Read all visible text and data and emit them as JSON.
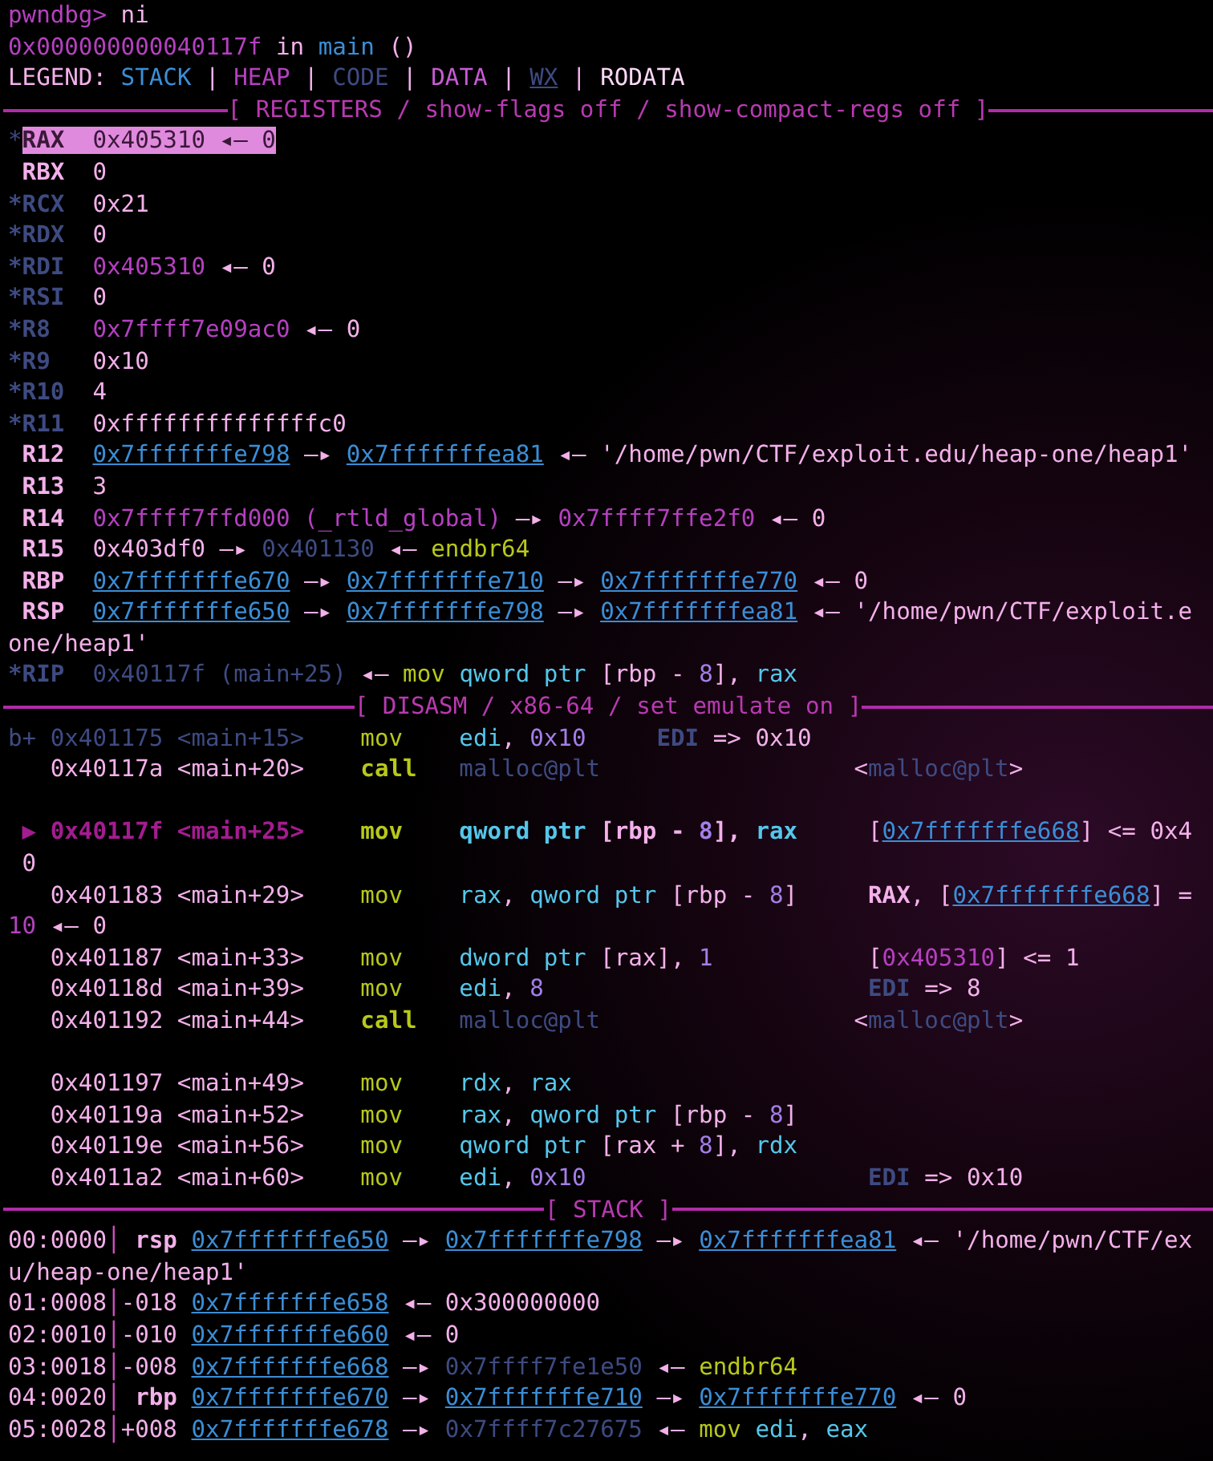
{
  "terminal": {
    "lines": [
      {
        "kind": "text",
        "segments": [
          {
            "text": "pwndbg> ",
            "kind": "heap"
          },
          {
            "text": "ni",
            "kind": "fg"
          }
        ]
      },
      {
        "kind": "text",
        "segments": [
          {
            "text": "0x000000000040117f",
            "kind": "heap"
          },
          {
            "text": " in ",
            "kind": "fg"
          },
          {
            "text": "main",
            "kind": "blue"
          },
          {
            "text": " ()",
            "kind": "fg"
          }
        ]
      },
      {
        "kind": "text",
        "segments": [
          {
            "text": "LEGEND: ",
            "kind": "fg"
          },
          {
            "text": "STACK",
            "kind": "blue"
          },
          {
            "text": " | ",
            "kind": "fg"
          },
          {
            "text": "HEAP",
            "kind": "heap"
          },
          {
            "text": " | ",
            "kind": "fg"
          },
          {
            "text": "CODE",
            "kind": "code"
          },
          {
            "text": " | ",
            "kind": "fg"
          },
          {
            "text": "DATA",
            "kind": "data"
          },
          {
            "text": " | ",
            "kind": "fg"
          },
          {
            "text": "WX",
            "kind": "wx"
          },
          {
            "text": " | ",
            "kind": "fg"
          },
          {
            "text": "RODATA",
            "kind": "rodata"
          }
        ]
      },
      {
        "kind": "rule",
        "title": "[ REGISTERS / show-flags off / show-compact-regs off ]"
      },
      {
        "kind": "text",
        "segments": [
          {
            "text": "*",
            "kind": "code"
          },
          {
            "text": "RAX",
            "kind": "hl-bold"
          },
          {
            "text": "  0x405310 ◂— 0",
            "kind": "hl"
          }
        ]
      },
      {
        "kind": "text",
        "segments": [
          {
            "text": " RBX",
            "kind": "fg-bold"
          },
          {
            "text": "  0",
            "kind": "fg"
          }
        ]
      },
      {
        "kind": "text",
        "segments": [
          {
            "text": "*RCX",
            "kind": "code-bold"
          },
          {
            "text": "  0x21",
            "kind": "fg"
          }
        ]
      },
      {
        "kind": "text",
        "segments": [
          {
            "text": "*RDX",
            "kind": "code-bold"
          },
          {
            "text": "  0",
            "kind": "fg"
          }
        ]
      },
      {
        "kind": "text",
        "segments": [
          {
            "text": "*RDI",
            "kind": "code-bold"
          },
          {
            "text": "  0x405310",
            "kind": "heap"
          },
          {
            "text": " ◂— 0",
            "kind": "fg"
          }
        ]
      },
      {
        "kind": "text",
        "segments": [
          {
            "text": "*RSI",
            "kind": "code-bold"
          },
          {
            "text": "  0",
            "kind": "fg"
          }
        ]
      },
      {
        "kind": "text",
        "segments": [
          {
            "text": "*R8",
            "kind": "code-bold"
          },
          {
            "text": "   0x7ffff7e09ac0",
            "kind": "heap"
          },
          {
            "text": " ◂— 0",
            "kind": "fg"
          }
        ]
      },
      {
        "kind": "text",
        "segments": [
          {
            "text": "*R9",
            "kind": "code-bold"
          },
          {
            "text": "   0x10",
            "kind": "fg"
          }
        ]
      },
      {
        "kind": "text",
        "segments": [
          {
            "text": "*R10",
            "kind": "code-bold"
          },
          {
            "text": "  4",
            "kind": "fg"
          }
        ]
      },
      {
        "kind": "text",
        "segments": [
          {
            "text": "*R11",
            "kind": "code-bold"
          },
          {
            "text": "  0xffffffffffffffc0",
            "kind": "fg"
          }
        ]
      },
      {
        "kind": "text",
        "segments": [
          {
            "text": " R12  ",
            "kind": "fg-bold"
          },
          {
            "text": "0x7fffffffe798",
            "kind": "stack"
          },
          {
            "text": " —▸ ",
            "kind": "fg"
          },
          {
            "text": "0x7fffffffea81",
            "kind": "stack"
          },
          {
            "text": " ◂— '/home/pwn/CTF/exploit.edu/heap-one/heap1'",
            "kind": "fg"
          }
        ]
      },
      {
        "kind": "text",
        "segments": [
          {
            "text": " R13",
            "kind": "fg-bold"
          },
          {
            "text": "  3",
            "kind": "fg"
          }
        ]
      },
      {
        "kind": "text",
        "segments": [
          {
            "text": " R14",
            "kind": "fg-bold"
          },
          {
            "text": "  0x7ffff7ffd000 (_rtld_global)",
            "kind": "heap"
          },
          {
            "text": " —▸ ",
            "kind": "fg"
          },
          {
            "text": "0x7ffff7ffe2f0",
            "kind": "heap"
          },
          {
            "text": " ◂— 0",
            "kind": "fg"
          }
        ]
      },
      {
        "kind": "text",
        "segments": [
          {
            "text": " R15",
            "kind": "fg-bold"
          },
          {
            "text": "  0x403df0 —▸ ",
            "kind": "fg"
          },
          {
            "text": "0x401130",
            "kind": "code"
          },
          {
            "text": " ◂— ",
            "kind": "fg"
          },
          {
            "text": "endbr64",
            "kind": "yellow"
          }
        ]
      },
      {
        "kind": "text",
        "segments": [
          {
            "text": " RBP  ",
            "kind": "fg-bold"
          },
          {
            "text": "0x7fffffffe670",
            "kind": "stack"
          },
          {
            "text": " —▸ ",
            "kind": "fg"
          },
          {
            "text": "0x7fffffffe710",
            "kind": "stack"
          },
          {
            "text": " —▸ ",
            "kind": "fg"
          },
          {
            "text": "0x7fffffffe770",
            "kind": "stack"
          },
          {
            "text": " ◂— 0",
            "kind": "fg"
          }
        ]
      },
      {
        "kind": "text",
        "segments": [
          {
            "text": " RSP  ",
            "kind": "fg-bold"
          },
          {
            "text": "0x7fffffffe650",
            "kind": "stack"
          },
          {
            "text": " —▸ ",
            "kind": "fg"
          },
          {
            "text": "0x7fffffffe798",
            "kind": "stack"
          },
          {
            "text": " —▸ ",
            "kind": "fg"
          },
          {
            "text": "0x7fffffffea81",
            "kind": "stack"
          },
          {
            "text": " ◂— '/home/pwn/CTF/exploit.e",
            "kind": "fg"
          }
        ]
      },
      {
        "kind": "text",
        "segments": [
          {
            "text": "one/heap1'",
            "kind": "fg"
          }
        ]
      },
      {
        "kind": "text",
        "segments": [
          {
            "text": "*RIP",
            "kind": "code-bold"
          },
          {
            "text": "  0x40117f (main+25)",
            "kind": "code"
          },
          {
            "text": " ◂— ",
            "kind": "fg"
          },
          {
            "text": "mov ",
            "kind": "yellow"
          },
          {
            "text": "qword ptr",
            "kind": "cyan"
          },
          {
            "text": " [rbp - ",
            "kind": "fg"
          },
          {
            "text": "8",
            "kind": "num"
          },
          {
            "text": "], ",
            "kind": "fg"
          },
          {
            "text": "rax",
            "kind": "cyan"
          }
        ]
      },
      {
        "kind": "rule",
        "title": "[ DISASM / x86-64 / set emulate on ]"
      },
      {
        "kind": "text",
        "segments": [
          {
            "text": "b+ 0x401175 <main+15>    ",
            "kind": "code"
          },
          {
            "text": "mov    ",
            "kind": "yellow"
          },
          {
            "text": "edi",
            "kind": "cyan"
          },
          {
            "text": ", ",
            "kind": "fg"
          },
          {
            "text": "0x10     ",
            "kind": "num"
          },
          {
            "text": "EDI",
            "kind": "code-bold"
          },
          {
            "text": " => 0x10",
            "kind": "fg"
          }
        ]
      },
      {
        "kind": "text",
        "segments": [
          {
            "text": "   0x40117a <main+20>    ",
            "kind": "fg"
          },
          {
            "text": "call   ",
            "kind": "yellow-bold"
          },
          {
            "text": "malloc@plt",
            "kind": "code"
          },
          {
            "text": "                  <",
            "kind": "fg"
          },
          {
            "text": "malloc@plt",
            "kind": "code"
          },
          {
            "text": ">",
            "kind": "fg"
          }
        ]
      },
      {
        "kind": "blank"
      },
      {
        "kind": "text",
        "segments": [
          {
            "text": " ▶ 0x40117f <main+25>    ",
            "kind": "heap-bold"
          },
          {
            "text": "mov    ",
            "kind": "yellow-bold"
          },
          {
            "text": "qword ptr",
            "kind": "cyan-bold"
          },
          {
            "text": " [rbp - ",
            "kind": "fg-bold"
          },
          {
            "text": "8",
            "kind": "num-bold"
          },
          {
            "text": "], ",
            "kind": "fg-bold"
          },
          {
            "text": "rax",
            "kind": "cyan-bold"
          },
          {
            "text": "     [",
            "kind": "fg"
          },
          {
            "text": "0x7fffffffe668",
            "kind": "stack"
          },
          {
            "text": "] <= 0x4",
            "kind": "fg"
          }
        ]
      },
      {
        "kind": "text",
        "segments": [
          {
            "text": " 0",
            "kind": "fg"
          }
        ]
      },
      {
        "kind": "text",
        "segments": [
          {
            "text": "   0x401183 <main+29>    ",
            "kind": "fg"
          },
          {
            "text": "mov    ",
            "kind": "yellow"
          },
          {
            "text": "rax",
            "kind": "cyan"
          },
          {
            "text": ", ",
            "kind": "fg"
          },
          {
            "text": "qword ptr",
            "kind": "cyan"
          },
          {
            "text": " [rbp - ",
            "kind": "fg"
          },
          {
            "text": "8",
            "kind": "num"
          },
          {
            "text": "]     ",
            "kind": "fg"
          },
          {
            "text": "RAX",
            "kind": "fg-bold"
          },
          {
            "text": ", [",
            "kind": "fg"
          },
          {
            "text": "0x7fffffffe668",
            "kind": "stack"
          },
          {
            "text": "] =",
            "kind": "fg"
          }
        ]
      },
      {
        "kind": "text",
        "segments": [
          {
            "text": "10",
            "kind": "heap"
          },
          {
            "text": " ◂— 0",
            "kind": "fg"
          }
        ]
      },
      {
        "kind": "text",
        "segments": [
          {
            "text": "   0x401187 <main+33>    ",
            "kind": "fg"
          },
          {
            "text": "mov    ",
            "kind": "yellow"
          },
          {
            "text": "dword ptr",
            "kind": "cyan"
          },
          {
            "text": " [rax], ",
            "kind": "fg"
          },
          {
            "text": "1",
            "kind": "num"
          },
          {
            "text": "           [",
            "kind": "fg"
          },
          {
            "text": "0x405310",
            "kind": "heap"
          },
          {
            "text": "] <= 1",
            "kind": "fg"
          }
        ]
      },
      {
        "kind": "text",
        "segments": [
          {
            "text": "   0x40118d <main+39>    ",
            "kind": "fg"
          },
          {
            "text": "mov    ",
            "kind": "yellow"
          },
          {
            "text": "edi",
            "kind": "cyan"
          },
          {
            "text": ", ",
            "kind": "fg"
          },
          {
            "text": "8                       ",
            "kind": "num"
          },
          {
            "text": "EDI",
            "kind": "code-bold"
          },
          {
            "text": " => 8",
            "kind": "fg"
          }
        ]
      },
      {
        "kind": "text",
        "segments": [
          {
            "text": "   0x401192 <main+44>    ",
            "kind": "fg"
          },
          {
            "text": "call   ",
            "kind": "yellow-bold"
          },
          {
            "text": "malloc@plt",
            "kind": "code"
          },
          {
            "text": "                  <",
            "kind": "fg"
          },
          {
            "text": "malloc@plt",
            "kind": "code"
          },
          {
            "text": ">",
            "kind": "fg"
          }
        ]
      },
      {
        "kind": "blank"
      },
      {
        "kind": "text",
        "segments": [
          {
            "text": "   0x401197 <main+49>    ",
            "kind": "fg"
          },
          {
            "text": "mov    ",
            "kind": "yellow"
          },
          {
            "text": "rdx",
            "kind": "cyan"
          },
          {
            "text": ", ",
            "kind": "fg"
          },
          {
            "text": "rax",
            "kind": "cyan"
          }
        ]
      },
      {
        "kind": "text",
        "segments": [
          {
            "text": "   0x40119a <main+52>    ",
            "kind": "fg"
          },
          {
            "text": "mov    ",
            "kind": "yellow"
          },
          {
            "text": "rax",
            "kind": "cyan"
          },
          {
            "text": ", ",
            "kind": "fg"
          },
          {
            "text": "qword ptr",
            "kind": "cyan"
          },
          {
            "text": " [rbp - ",
            "kind": "fg"
          },
          {
            "text": "8",
            "kind": "num"
          },
          {
            "text": "]",
            "kind": "fg"
          }
        ]
      },
      {
        "kind": "text",
        "segments": [
          {
            "text": "   0x40119e <main+56>    ",
            "kind": "fg"
          },
          {
            "text": "mov    ",
            "kind": "yellow"
          },
          {
            "text": "qword ptr",
            "kind": "cyan"
          },
          {
            "text": " [rax + ",
            "kind": "fg"
          },
          {
            "text": "8",
            "kind": "num"
          },
          {
            "text": "], ",
            "kind": "fg"
          },
          {
            "text": "rdx",
            "kind": "cyan"
          }
        ]
      },
      {
        "kind": "text",
        "segments": [
          {
            "text": "   0x4011a2 <main+60>    ",
            "kind": "fg"
          },
          {
            "text": "mov    ",
            "kind": "yellow"
          },
          {
            "text": "edi",
            "kind": "cyan"
          },
          {
            "text": ", ",
            "kind": "fg"
          },
          {
            "text": "0x10                    ",
            "kind": "num"
          },
          {
            "text": "EDI",
            "kind": "code-bold"
          },
          {
            "text": " => 0x10",
            "kind": "fg"
          }
        ]
      },
      {
        "kind": "rule",
        "title": "[ STACK ]"
      },
      {
        "kind": "text",
        "segments": [
          {
            "text": "00:0000",
            "kind": "fg"
          },
          {
            "text": "│",
            "kind": "bar"
          },
          {
            "text": " rsp ",
            "kind": "fg-bold"
          },
          {
            "text": "0x7fffffffe650",
            "kind": "stack"
          },
          {
            "text": " —▸ ",
            "kind": "fg"
          },
          {
            "text": "0x7fffffffe798",
            "kind": "stack"
          },
          {
            "text": " —▸ ",
            "kind": "fg"
          },
          {
            "text": "0x7fffffffea81",
            "kind": "stack"
          },
          {
            "text": " ◂— '/home/pwn/CTF/ex",
            "kind": "fg"
          }
        ]
      },
      {
        "kind": "text",
        "segments": [
          {
            "text": "u/heap-one/heap1'",
            "kind": "fg"
          }
        ]
      },
      {
        "kind": "text",
        "segments": [
          {
            "text": "01:0008",
            "kind": "fg"
          },
          {
            "text": "│",
            "kind": "bar"
          },
          {
            "text": "-018 ",
            "kind": "fg"
          },
          {
            "text": "0x7fffffffe658",
            "kind": "stack"
          },
          {
            "text": " ◂— 0x300000000",
            "kind": "fg"
          }
        ]
      },
      {
        "kind": "text",
        "segments": [
          {
            "text": "02:0010",
            "kind": "fg"
          },
          {
            "text": "│",
            "kind": "bar"
          },
          {
            "text": "-010 ",
            "kind": "fg"
          },
          {
            "text": "0x7fffffffe660",
            "kind": "stack"
          },
          {
            "text": " ◂— 0",
            "kind": "fg"
          }
        ]
      },
      {
        "kind": "text",
        "segments": [
          {
            "text": "03:0018",
            "kind": "fg"
          },
          {
            "text": "│",
            "kind": "bar"
          },
          {
            "text": "-008 ",
            "kind": "fg"
          },
          {
            "text": "0x7fffffffe668",
            "kind": "stack"
          },
          {
            "text": " —▸ ",
            "kind": "fg"
          },
          {
            "text": "0x7ffff7fe1e50",
            "kind": "code"
          },
          {
            "text": " ◂— ",
            "kind": "fg"
          },
          {
            "text": "endbr64",
            "kind": "yellow"
          }
        ]
      },
      {
        "kind": "text",
        "segments": [
          {
            "text": "04:0020",
            "kind": "fg"
          },
          {
            "text": "│",
            "kind": "bar"
          },
          {
            "text": " rbp ",
            "kind": "fg-bold"
          },
          {
            "text": "0x7fffffffe670",
            "kind": "stack"
          },
          {
            "text": " —▸ ",
            "kind": "fg"
          },
          {
            "text": "0x7fffffffe710",
            "kind": "stack"
          },
          {
            "text": " —▸ ",
            "kind": "fg"
          },
          {
            "text": "0x7fffffffe770",
            "kind": "stack"
          },
          {
            "text": " ◂— 0",
            "kind": "fg"
          }
        ]
      },
      {
        "kind": "text",
        "segments": [
          {
            "text": "05:0028",
            "kind": "fg"
          },
          {
            "text": "│",
            "kind": "bar"
          },
          {
            "text": "+008 ",
            "kind": "fg"
          },
          {
            "text": "0x7fffffffe678",
            "kind": "stack"
          },
          {
            "text": " —▸ ",
            "kind": "fg"
          },
          {
            "text": "0x7ffff7c27675",
            "kind": "code"
          },
          {
            "text": " ◂— ",
            "kind": "fg"
          },
          {
            "text": "mov ",
            "kind": "yellow"
          },
          {
            "text": "edi",
            "kind": "cyan"
          },
          {
            "text": ", ",
            "kind": "fg"
          },
          {
            "text": "eax",
            "kind": "cyan"
          }
        ]
      }
    ]
  }
}
